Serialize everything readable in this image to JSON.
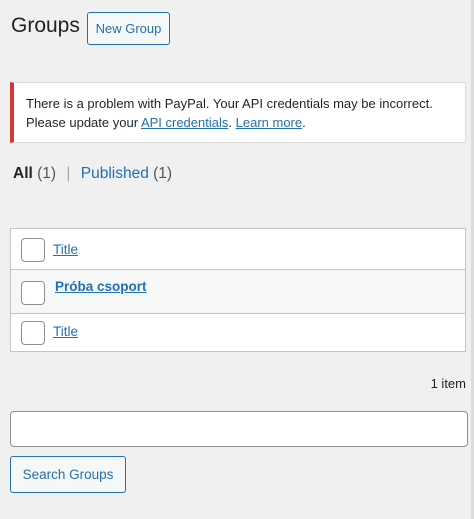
{
  "page": {
    "title": "Groups",
    "new_group_label": "New Group"
  },
  "notice": {
    "text": "There is a problem with PayPal. Your API credentials may be incorrect. Please update your",
    "link1": "API credentials",
    "sep": ".",
    "link2": "Learn more",
    "end": "."
  },
  "filters": {
    "all_label": "All",
    "all_count": "(1)",
    "separator": "|",
    "published_label": "Published",
    "published_count": "(1)"
  },
  "table": {
    "header_title": "Title",
    "footer_title": "Title",
    "rows": [
      {
        "title": "Próba csoport"
      }
    ]
  },
  "pagination": {
    "item_count": "1 item"
  },
  "search": {
    "value": "",
    "button_label": "Search Groups"
  }
}
